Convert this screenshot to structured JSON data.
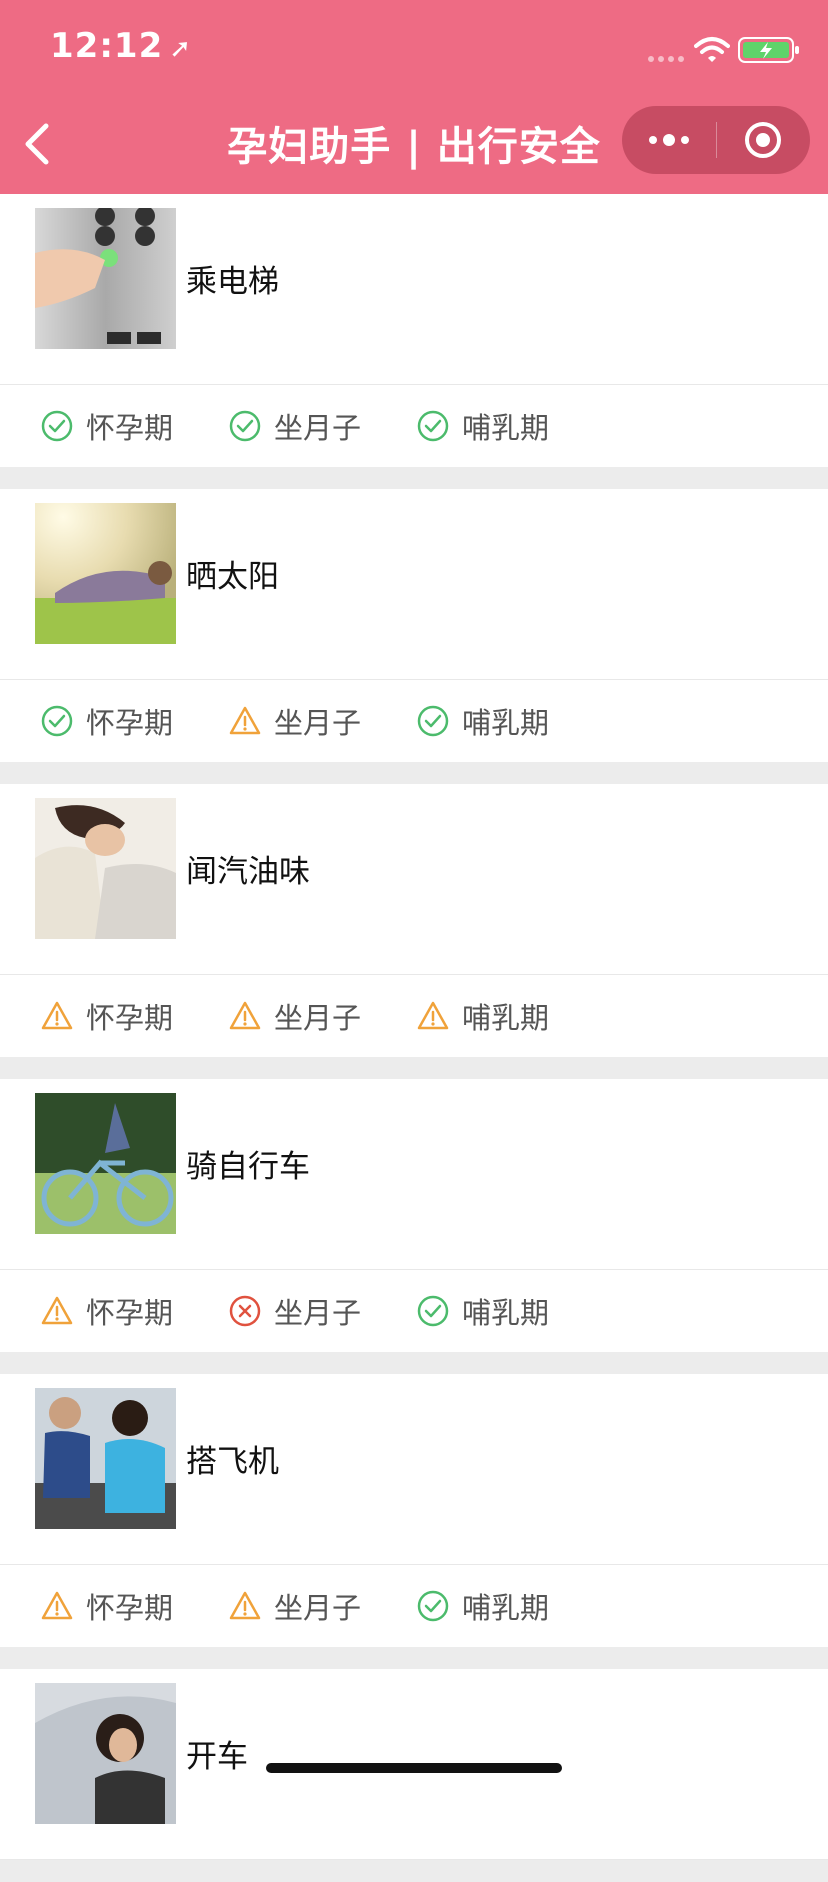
{
  "status_bar": {
    "time": "12:12"
  },
  "nav": {
    "title": "孕妇助手 | 出行安全"
  },
  "items": [
    {
      "name": "乘电梯",
      "thumb_icon": "elevator-photo",
      "tags": [
        {
          "label": "怀孕期",
          "status": "safe"
        },
        {
          "label": "坐月子",
          "status": "safe"
        },
        {
          "label": "哺乳期",
          "status": "safe"
        }
      ]
    },
    {
      "name": "晒太阳",
      "thumb_icon": "sunbathing-photo",
      "tags": [
        {
          "label": "怀孕期",
          "status": "safe"
        },
        {
          "label": "坐月子",
          "status": "caution"
        },
        {
          "label": "哺乳期",
          "status": "safe"
        }
      ]
    },
    {
      "name": "闻汽油味",
      "thumb_icon": "gasoline-smell-photo",
      "tags": [
        {
          "label": "怀孕期",
          "status": "caution"
        },
        {
          "label": "坐月子",
          "status": "caution"
        },
        {
          "label": "哺乳期",
          "status": "caution"
        }
      ]
    },
    {
      "name": "骑自行车",
      "thumb_icon": "bicycle-photo",
      "tags": [
        {
          "label": "怀孕期",
          "status": "caution"
        },
        {
          "label": "坐月子",
          "status": "forbidden"
        },
        {
          "label": "哺乳期",
          "status": "safe"
        }
      ]
    },
    {
      "name": "搭飞机",
      "thumb_icon": "airplane-photo",
      "tags": [
        {
          "label": "怀孕期",
          "status": "caution"
        },
        {
          "label": "坐月子",
          "status": "caution"
        },
        {
          "label": "哺乳期",
          "status": "safe"
        }
      ]
    },
    {
      "name": "开车",
      "thumb_icon": "driving-photo",
      "tags": []
    }
  ],
  "colors": {
    "header": "#ee6b84",
    "safe": "#4cbb6c",
    "caution": "#f0a23a",
    "forbidden": "#e0523f"
  }
}
